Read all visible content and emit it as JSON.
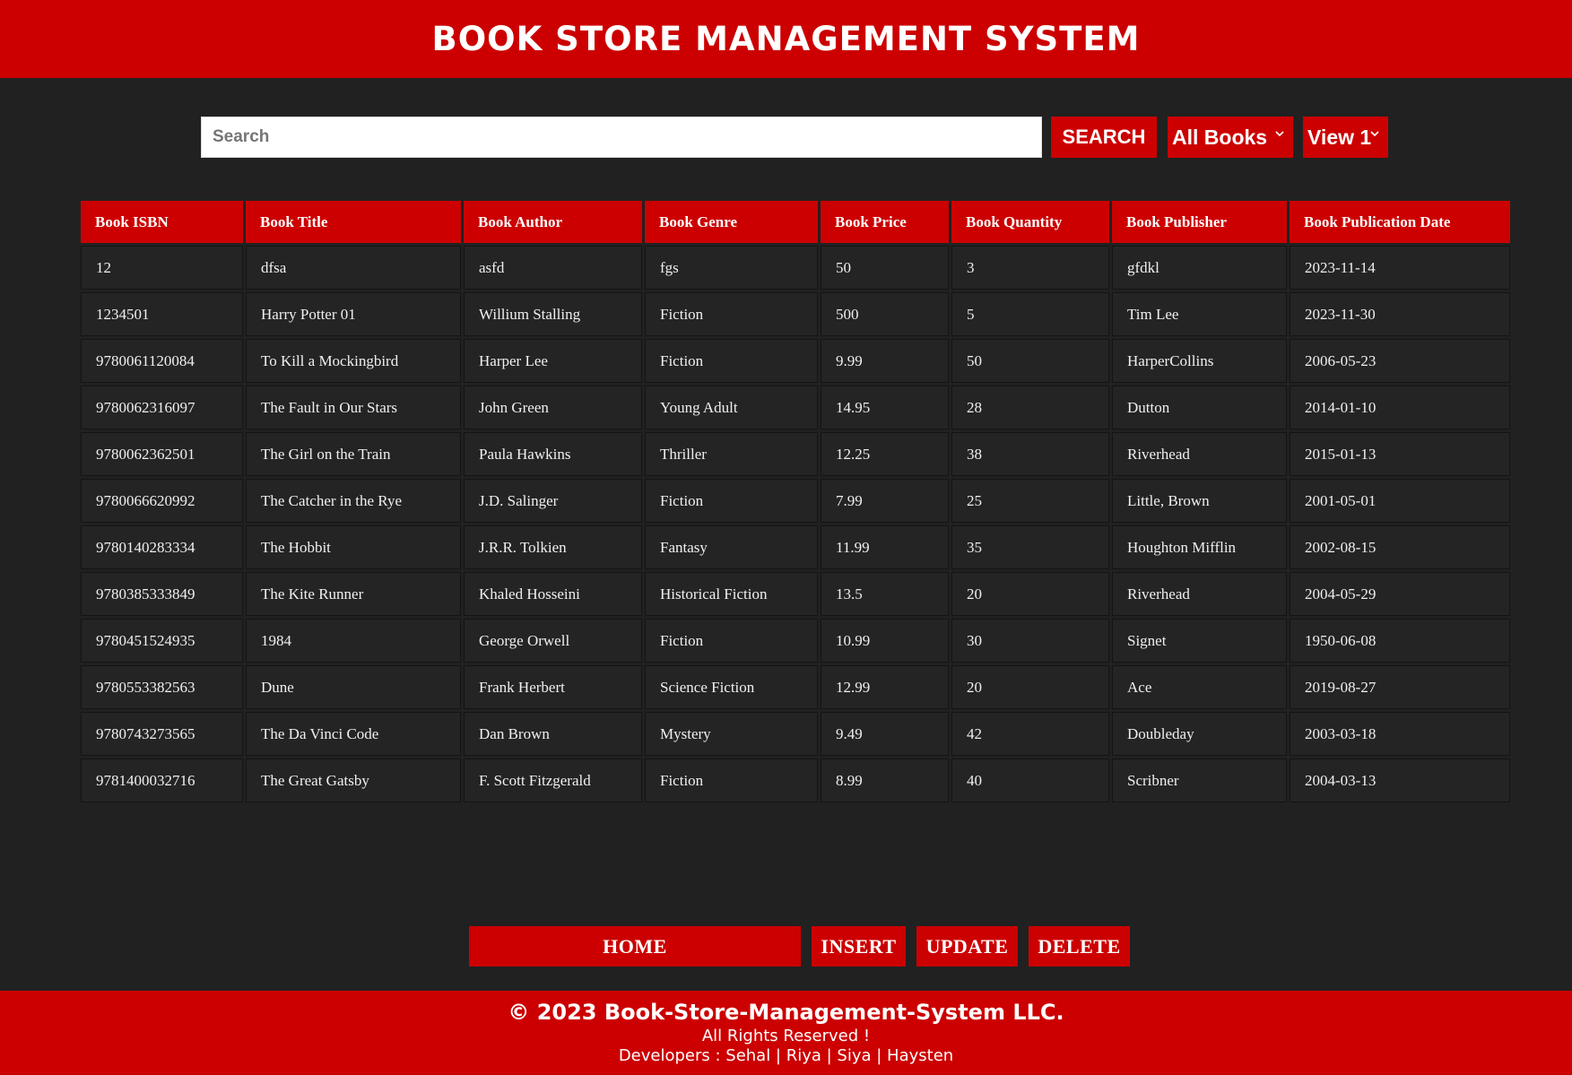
{
  "header": {
    "title": "BOOK STORE MANAGEMENT SYSTEM"
  },
  "search": {
    "placeholder": "Search",
    "value": "",
    "button_label": "SEARCH",
    "filter_selected": "All Books",
    "view_selected": "View 1"
  },
  "table": {
    "columns": [
      "Book ISBN",
      "Book Title",
      "Book Author",
      "Book Genre",
      "Book Price",
      "Book Quantity",
      "Book Publisher",
      "Book Publication Date"
    ],
    "rows": [
      [
        "12",
        "dfsa",
        "asfd",
        "fgs",
        "50",
        "3",
        "gfdkl",
        "2023-11-14"
      ],
      [
        "1234501",
        "Harry Potter 01",
        "Willium Stalling",
        "Fiction",
        "500",
        "5",
        "Tim Lee",
        "2023-11-30"
      ],
      [
        "9780061120084",
        "To Kill a Mockingbird",
        "Harper Lee",
        "Fiction",
        "9.99",
        "50",
        "HarperCollins",
        "2006-05-23"
      ],
      [
        "9780062316097",
        "The Fault in Our Stars",
        "John Green",
        "Young Adult",
        "14.95",
        "28",
        "Dutton",
        "2014-01-10"
      ],
      [
        "9780062362501",
        "The Girl on the Train",
        "Paula Hawkins",
        "Thriller",
        "12.25",
        "38",
        "Riverhead",
        "2015-01-13"
      ],
      [
        "9780066620992",
        "The Catcher in the Rye",
        "J.D. Salinger",
        "Fiction",
        "7.99",
        "25",
        "Little, Brown",
        "2001-05-01"
      ],
      [
        "9780140283334",
        "The Hobbit",
        "J.R.R. Tolkien",
        "Fantasy",
        "11.99",
        "35",
        "Houghton Mifflin",
        "2002-08-15"
      ],
      [
        "9780385333849",
        "The Kite Runner",
        "Khaled Hosseini",
        "Historical Fiction",
        "13.5",
        "20",
        "Riverhead",
        "2004-05-29"
      ],
      [
        "9780451524935",
        "1984",
        "George Orwell",
        "Fiction",
        "10.99",
        "30",
        "Signet",
        "1950-06-08"
      ],
      [
        "9780553382563",
        "Dune",
        "Frank Herbert",
        "Science Fiction",
        "12.99",
        "20",
        "Ace",
        "2019-08-27"
      ],
      [
        "9780743273565",
        "The Da Vinci Code",
        "Dan Brown",
        "Mystery",
        "9.49",
        "42",
        "Doubleday",
        "2003-03-18"
      ],
      [
        "9781400032716",
        "The Great Gatsby",
        "F. Scott Fitzgerald",
        "Fiction",
        "8.99",
        "40",
        "Scribner",
        "2004-03-13"
      ]
    ]
  },
  "nav": {
    "home": "HOME",
    "insert": "INSERT",
    "update": "UPDATE",
    "delete": "DELETE"
  },
  "footer": {
    "copyright": "© 2023 Book-Store-Management-System LLC.",
    "rights": "All Rights Reserved !",
    "developers": "Developers : Sehal | Riya | Siya | Haysten"
  },
  "colors": {
    "accent": "#cc0000",
    "background": "#212121",
    "cell": "#242424"
  }
}
